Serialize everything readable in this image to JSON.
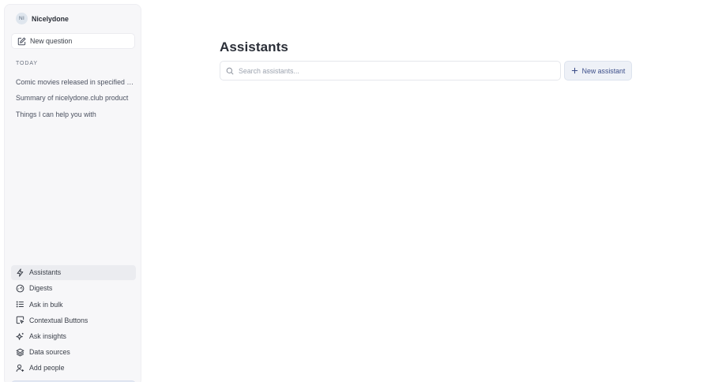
{
  "workspace": {
    "initials": "NI",
    "name": "Nicelydone"
  },
  "sidebar": {
    "new_question_label": "New question",
    "section_title": "TODAY",
    "history": [
      "Comic movies released in specified dates",
      "Summary of nicelydone.club product",
      "Things I can help you with"
    ],
    "nav": [
      {
        "label": "Assistants",
        "icon": "lightning-icon",
        "active": true
      },
      {
        "label": "Digests",
        "icon": "gauge-icon"
      },
      {
        "label": "Ask in bulk",
        "icon": "list-icon"
      },
      {
        "label": "Contextual Buttons",
        "icon": "cursor-square-icon"
      },
      {
        "label": "Ask insights",
        "icon": "sparkle-icon"
      },
      {
        "label": "Data sources",
        "icon": "layers-icon"
      },
      {
        "label": "Add people",
        "icon": "user-plus-icon"
      }
    ]
  },
  "main": {
    "title": "Assistants",
    "search_placeholder": "Search assistants...",
    "new_assistant_label": "New assistant"
  },
  "colors": {
    "accent": "#3d4f8a",
    "sidebar_bg": "#f7f7f9",
    "active_bg": "#ebecf0"
  }
}
